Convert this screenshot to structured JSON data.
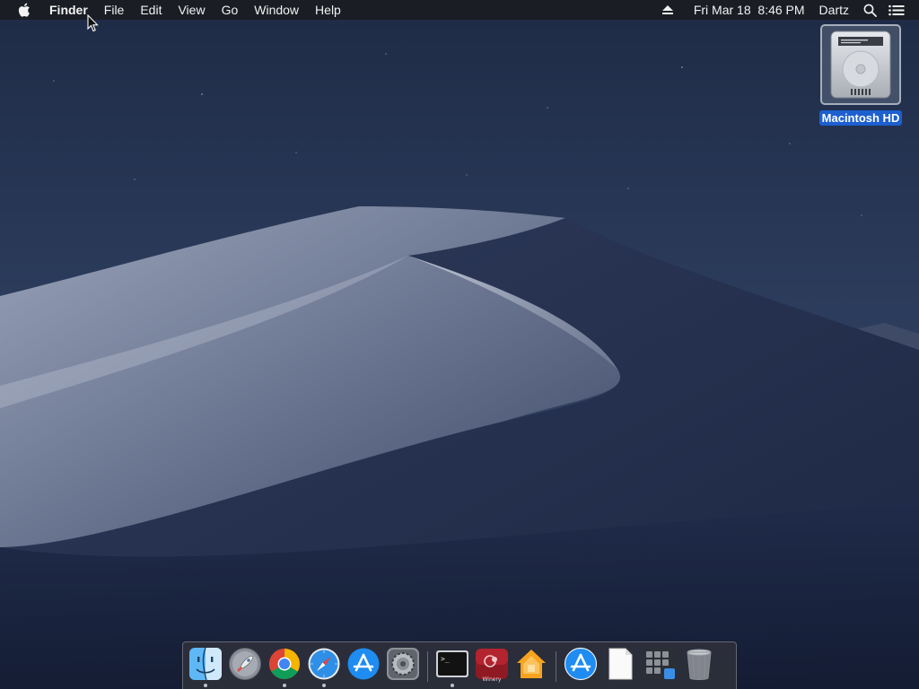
{
  "menubar": {
    "apple_icon": "apple-logo-icon",
    "app_name": "Finder",
    "menus": [
      "File",
      "Edit",
      "View",
      "Go",
      "Window",
      "Help"
    ],
    "eject_icon": "eject-icon",
    "datetime": "Fri Mar 18  8:46 PM",
    "user": "Dartz",
    "spotlight_icon": "search-icon",
    "notification_icon": "list-icon"
  },
  "desktop": {
    "icons": [
      {
        "label": "Macintosh HD",
        "icon": "hard-drive-icon",
        "selected": true
      }
    ]
  },
  "dock": {
    "apps": [
      {
        "icon": "finder-icon",
        "running": true
      },
      {
        "icon": "launchpad-rocket-icon",
        "running": false
      },
      {
        "icon": "chrome-icon",
        "running": true
      },
      {
        "icon": "safari-compass-icon",
        "running": true
      },
      {
        "icon": "app-store-icon",
        "running": false
      },
      {
        "icon": "system-preferences-gear-icon",
        "running": false
      },
      {
        "icon": "terminal-icon",
        "running": true
      },
      {
        "icon": "winery-icon",
        "label": "Winery",
        "running": false
      },
      {
        "icon": "home-app-icon",
        "running": false
      }
    ],
    "others": [
      {
        "icon": "app-store-folder-icon"
      },
      {
        "icon": "document-icon"
      },
      {
        "icon": "apps-grid-folder-icon"
      },
      {
        "icon": "trash-icon"
      }
    ]
  },
  "colors": {
    "menubar_bg": "#1a1c22",
    "selection": "#1d5fd0",
    "sky_top": "#1e2b46",
    "dune_light": "#b6bdd0"
  }
}
